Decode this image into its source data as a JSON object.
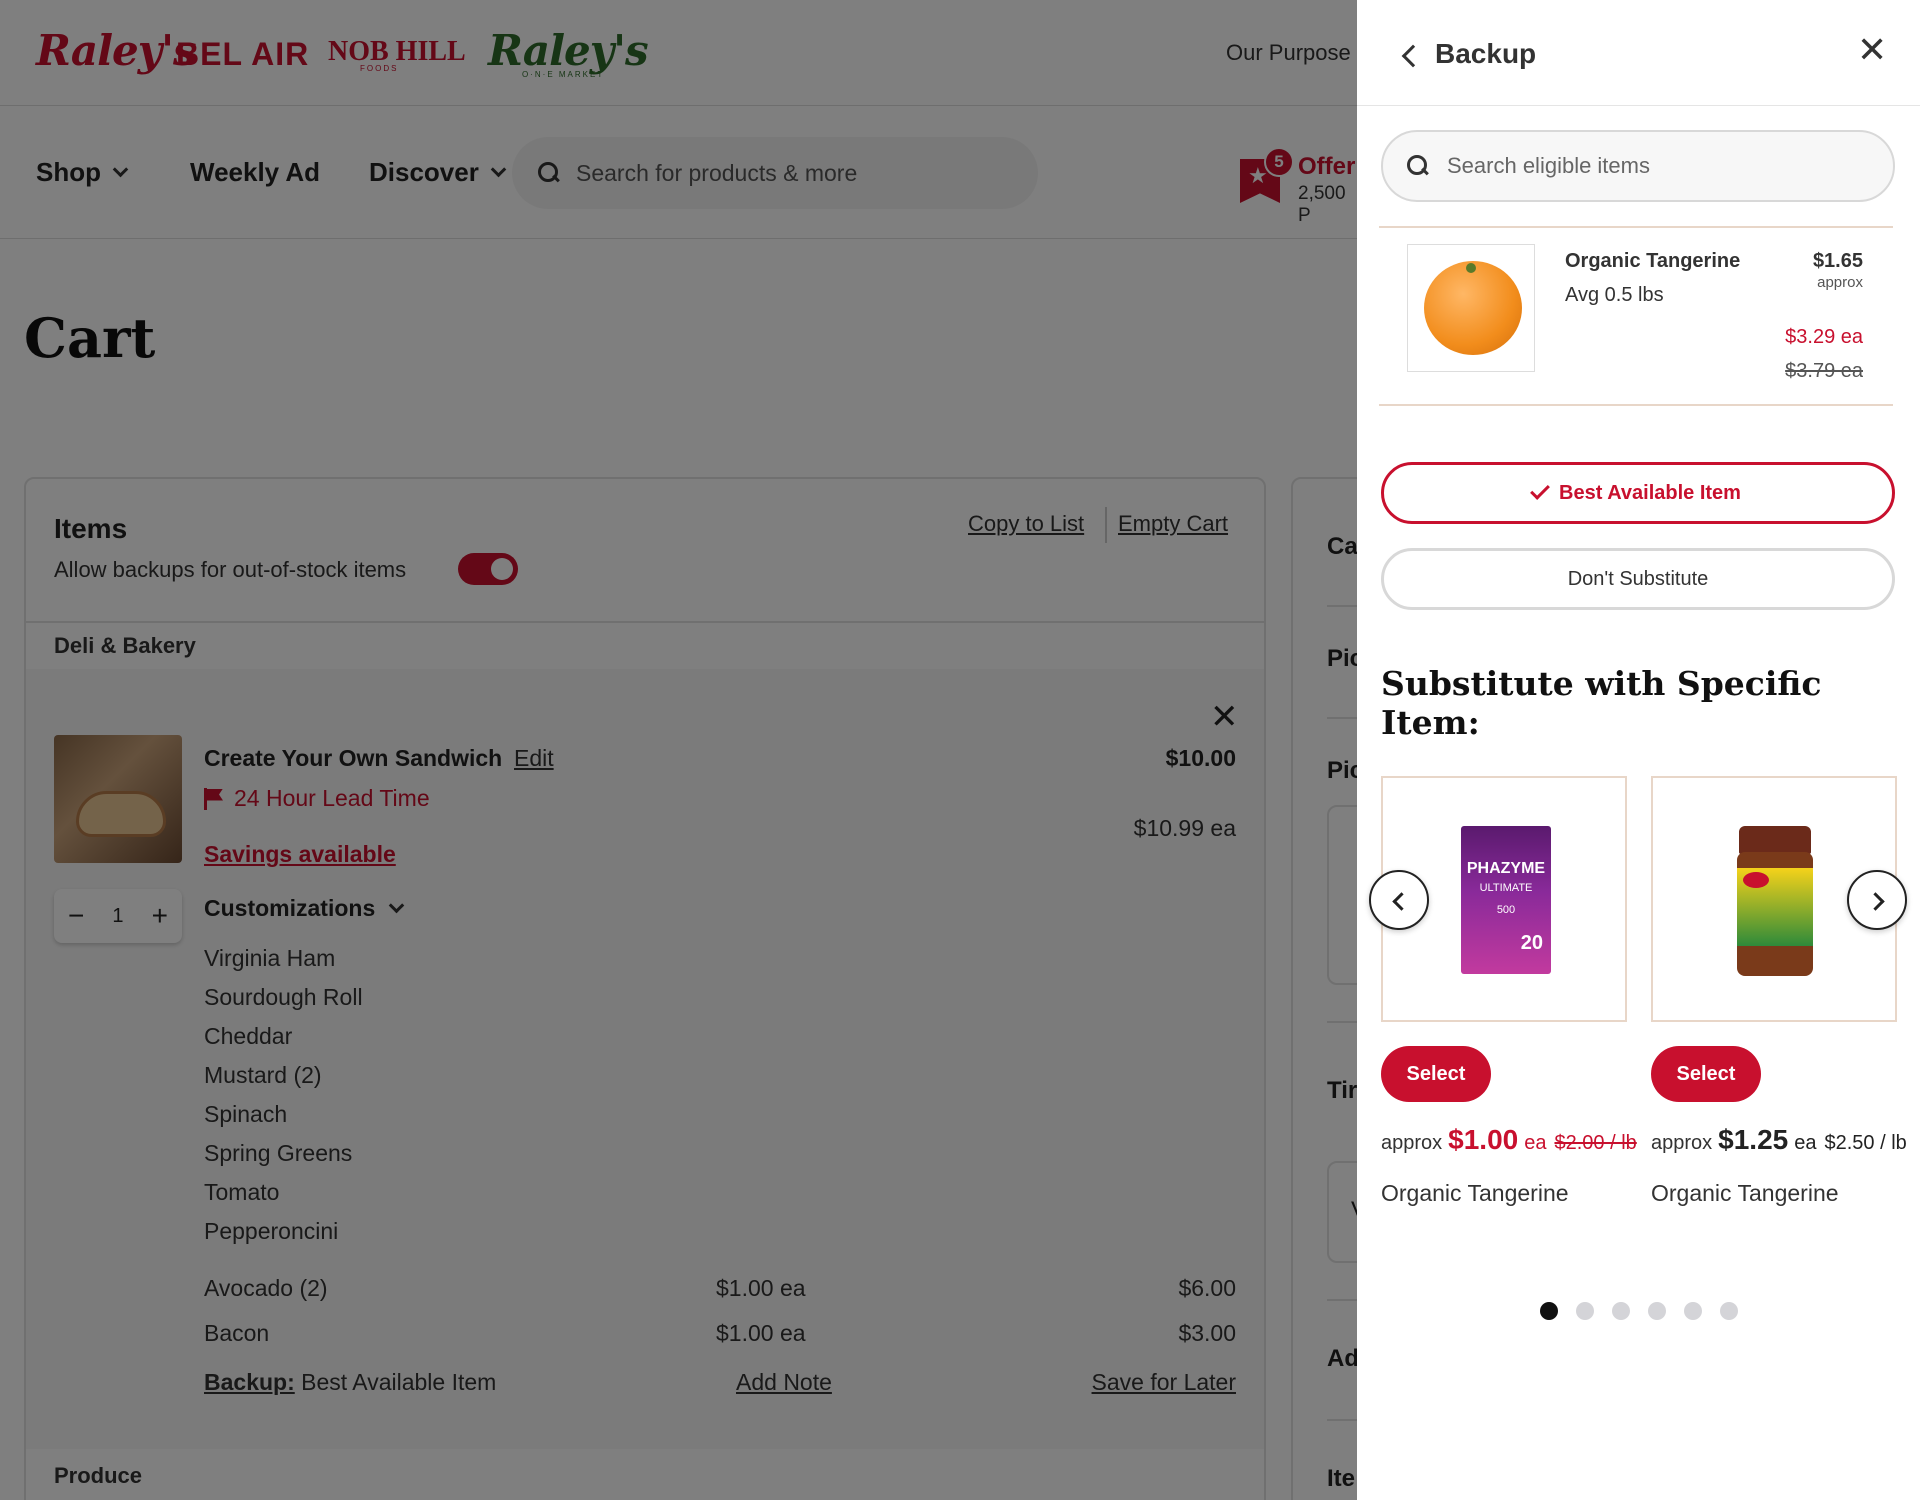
{
  "header": {
    "brands": [
      "Raley's",
      "BEL AIR",
      "NOB HILL",
      "Raley's"
    ],
    "brand_subs": [
      "FOODS",
      "O·N·E MARKET"
    ],
    "our_purpose": "Our Purpose"
  },
  "nav": {
    "shop": "Shop",
    "weekly_ad": "Weekly Ad",
    "discover": "Discover",
    "search_placeholder": "Search for products & more",
    "offers_count": "5",
    "offers_label": "Offer",
    "points": "2,500 P"
  },
  "cart": {
    "title": "Cart",
    "items_heading": "Items",
    "allow_backups": "Allow backups for out-of-stock items",
    "copy_to_list": "Copy to List",
    "empty_cart": "Empty Cart",
    "dept1": "Deli & Bakery",
    "dept2": "Produce",
    "item": {
      "name": "Create Your Own Sandwich",
      "edit": "Edit",
      "price": "$10.00",
      "lead_time": "24 Hour Lead Time",
      "each": "$10.99 ea",
      "savings": "Savings available",
      "qty": "1",
      "customizations_label": "Customizations",
      "customizations": [
        "Virginia Ham",
        "Sourdough Roll",
        "Cheddar",
        "Mustard (2)",
        "Spinach",
        "Spring Greens",
        "Tomato",
        "Pepperoncini"
      ],
      "addons": [
        {
          "name": "Avocado (2)",
          "each": "$1.00 ea",
          "total": "$6.00"
        },
        {
          "name": "Bacon",
          "each": "$1.00 ea",
          "total": "$3.00"
        }
      ],
      "backup_label": "Backup:",
      "backup_value": "Best Available Item",
      "add_note": "Add Note",
      "save_for_later": "Save for Later"
    }
  },
  "summary_fragments": [
    "Ca",
    "Pic",
    "Pic",
    "Tir",
    "V",
    "Ad",
    "Ite"
  ],
  "drawer": {
    "title": "Backup",
    "search_placeholder": "Search eligible items",
    "current_item": {
      "name": "Organic Tangerine",
      "avg": "Avg 0.5 lbs",
      "price": "$1.65",
      "approx": "approx",
      "sale": "$3.29 ea",
      "was": "$3.79 ea"
    },
    "best_available": "Best Available Item",
    "dont_substitute": "Don't Substitute",
    "substitute_heading": "Substitute with Specific Item:",
    "products": [
      {
        "select": "Select",
        "approx": "approx",
        "price": "$1.00",
        "ea": "ea",
        "per_lb": "$2.00 / lb",
        "name": "Organic Tangerine",
        "sale": true,
        "pack": {
          "brand": "PHAZYME",
          "line": "ULTIMATE",
          "dose": "500",
          "count": "20"
        }
      },
      {
        "select": "Select",
        "approx": "approx",
        "price": "$1.25",
        "ea": "ea",
        "per_lb": "$2.50 / lb",
        "name": "Organic Tangerine",
        "sale": false
      }
    ],
    "carousel": {
      "pages": 6,
      "active": 0
    }
  },
  "colors": {
    "accent": "#c8102e",
    "dot_inactive": "#d4d4d8",
    "dot_active": "#111111"
  }
}
